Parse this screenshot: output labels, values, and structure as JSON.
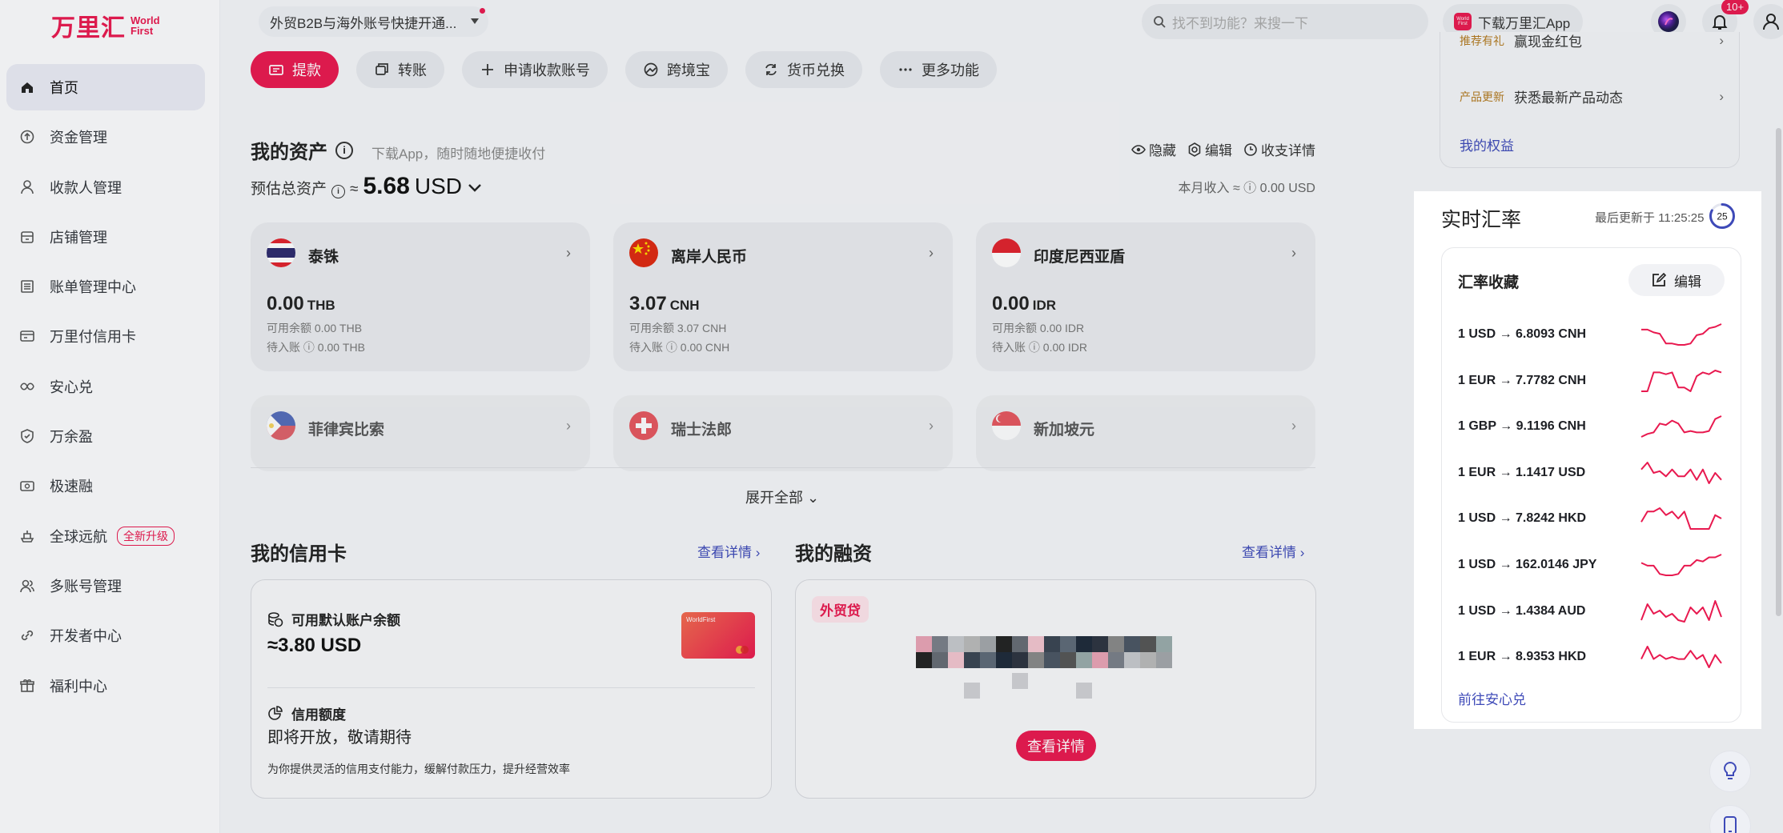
{
  "brand": {
    "logo_cn": "万里汇",
    "logo_en": "World First",
    "accent": "#e8194f"
  },
  "topbar": {
    "entity": "外贸B2B与海外账号快捷开通...",
    "search_placeholder": "找不到功能？来搜一下",
    "download_app": "下载万里汇App",
    "download_logo_text": "World First",
    "notif_count": "10+"
  },
  "sidebar": {
    "items": [
      {
        "label": "首页",
        "icon": "home-icon"
      },
      {
        "label": "资金管理",
        "icon": "fund-icon"
      },
      {
        "label": "收款人管理",
        "icon": "user-icon"
      },
      {
        "label": "店铺管理",
        "icon": "store-icon"
      },
      {
        "label": "账单管理中心",
        "icon": "bill-icon"
      },
      {
        "label": "万里付信用卡",
        "icon": "card-icon"
      },
      {
        "label": "安心兑",
        "icon": "exchange-icon"
      },
      {
        "label": "万余盈",
        "icon": "shield-icon"
      },
      {
        "label": "极速融",
        "icon": "finance-icon"
      },
      {
        "label": "全球远航",
        "icon": "ship-icon",
        "badge": "全新升级"
      },
      {
        "label": "多账号管理",
        "icon": "multi-user-icon"
      },
      {
        "label": "开发者中心",
        "icon": "link-icon"
      },
      {
        "label": "福利中心",
        "icon": "gift-icon"
      }
    ]
  },
  "actions": [
    "提款",
    "转账",
    "申请收款账号",
    "跨境宝",
    "货币兑换",
    "更多功能"
  ],
  "assets": {
    "title": "我的资产",
    "subtitle": "下载App，随时随地便捷收付",
    "hide": "隐藏",
    "edit": "编辑",
    "details": "收支详情",
    "total_label": "预估总资产",
    "approx": "≈",
    "total_amount": "5.68",
    "total_currency": "USD",
    "month_income": "本月收入 ≈ ⓘ 0.00 USD",
    "expand": "展开全部"
  },
  "currency_cards": [
    {
      "name": "泰铢",
      "amount": "0.00",
      "code": "THB",
      "avail": "可用余额 0.00 THB",
      "pending": "待入账 ⓘ 0.00 THB",
      "flag": "th"
    },
    {
      "name": "离岸人民币",
      "amount": "3.07",
      "code": "CNH",
      "avail": "可用余额 3.07 CNH",
      "pending": "待入账 ⓘ 0.00 CNH",
      "flag": "cn"
    },
    {
      "name": "印度尼西亚盾",
      "amount": "0.00",
      "code": "IDR",
      "avail": "可用余额 0.00 IDR",
      "pending": "待入账 ⓘ 0.00 IDR",
      "flag": "id"
    },
    {
      "name": "菲律宾比索",
      "flag": "ph"
    },
    {
      "name": "瑞士法郎",
      "flag": "ch"
    },
    {
      "name": "新加坡元",
      "flag": "sg"
    }
  ],
  "credit": {
    "title": "我的信用卡",
    "link": "查看详情",
    "avail_label": "可用默认账户余额",
    "avail_amount": "≈3.80 USD",
    "card_text": "WorldFirst",
    "limit_label": "信用额度",
    "coming": "即将开放，敬请期待",
    "desc": "为你提供灵活的信用支付能力，缓解付款压力，提升经营效率"
  },
  "financing": {
    "title": "我的融资",
    "link": "查看详情",
    "tag": "外贸贷",
    "button": "查看详情"
  },
  "right_top": {
    "rows": [
      {
        "tag": "推荐有礼",
        "text": "赢现金红包"
      },
      {
        "tag": "产品更新",
        "text": "获悉最新产品动态"
      }
    ],
    "link": "我的权益"
  },
  "rates": {
    "title": "实时汇率",
    "updated": "最后更新于 11:25:25",
    "countdown": "25",
    "countdown_fraction": 0.83,
    "fav_title": "汇率收藏",
    "edit": "编辑",
    "goto": "前往安心兑",
    "line_color": "#e8194f",
    "items": [
      {
        "pair": "1 USD → 6.8093 CNH",
        "trend": [
          4,
          4,
          6,
          7,
          14,
          14,
          15,
          15,
          14,
          8,
          7,
          3,
          2,
          0
        ]
      },
      {
        "pair": "1 EUR → 7.7782 CNH",
        "trend": [
          14,
          14,
          4,
          4,
          5,
          4,
          12,
          12,
          14,
          6,
          4,
          5,
          3,
          4
        ]
      },
      {
        "pair": "1 GBP → 9.1196 CNH",
        "trend": [
          14,
          12,
          11,
          5,
          6,
          3,
          5,
          11,
          10,
          11,
          11,
          10,
          2,
          0
        ]
      },
      {
        "pair": "1 EUR → 1.1417 USD",
        "trend": [
          6,
          2,
          8,
          7,
          10,
          6,
          10,
          10,
          6,
          12,
          6,
          14,
          8,
          12
        ]
      },
      {
        "pair": "1 USD → 7.8242 HKD",
        "trend": [
          10,
          4,
          4,
          2,
          6,
          4,
          8,
          4,
          14,
          14,
          14,
          14,
          6,
          8
        ]
      },
      {
        "pair": "1 USD → 162.0146 JPY",
        "trend": [
          6,
          8,
          8,
          14,
          15,
          15,
          14,
          8,
          8,
          4,
          5,
          2,
          2,
          0
        ]
      },
      {
        "pair": "1 USD → 1.4384 AUD",
        "trend": [
          12,
          2,
          8,
          6,
          10,
          8,
          12,
          13,
          4,
          8,
          4,
          12,
          0,
          10
        ]
      },
      {
        "pair": "1 EUR → 8.9353 HKD",
        "trend": [
          8,
          2,
          8,
          6,
          8,
          7,
          8,
          8,
          4,
          8,
          6,
          12,
          6,
          10
        ]
      }
    ]
  }
}
